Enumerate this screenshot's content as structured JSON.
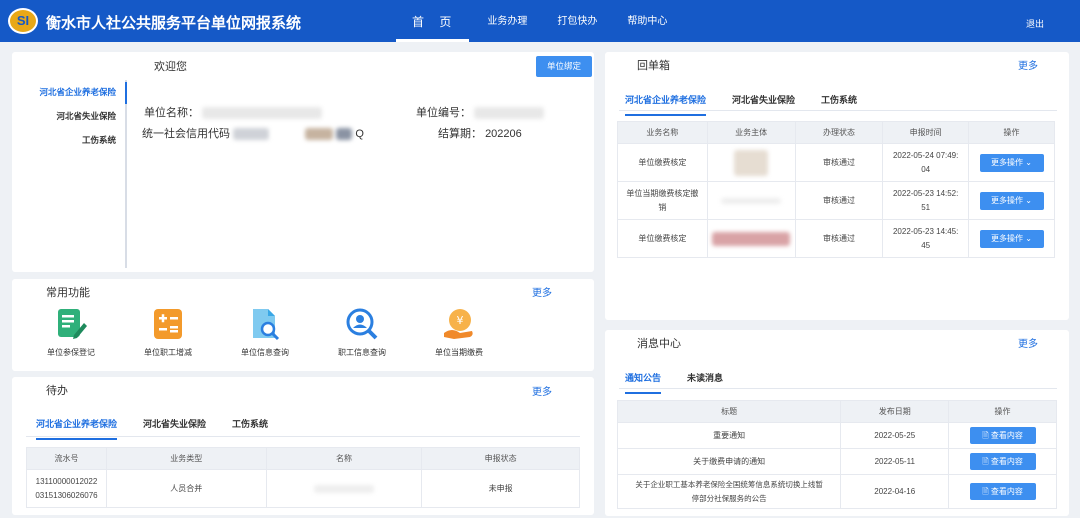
{
  "header": {
    "logo_text": "SI",
    "title": "衡水市人社公共服务平台单位网报系统",
    "nav": [
      "首 页",
      "业务办理",
      "打包快办",
      "帮助中心"
    ],
    "logout": "退出"
  },
  "welcome": {
    "title": "欢迎您",
    "button": "单位绑定",
    "tabs": [
      "河北省企业养老保险",
      "河北省失业保险",
      "工伤系统"
    ],
    "unit_name_label": "单位名称：",
    "unit_code_label": "单位编号：",
    "credit_code_label": "统一社会信用代码",
    "credit_code_tail": "Q",
    "settle_label": "结算期：",
    "settle_value": "202206"
  },
  "common": {
    "title": "常用功能",
    "more": "更多",
    "items": [
      {
        "label": "单位参保登记",
        "icon": "register-edit-icon",
        "color": "#2fb07a"
      },
      {
        "label": "单位职工增减",
        "icon": "calculator-icon",
        "color": "#f39a2b"
      },
      {
        "label": "单位信息查询",
        "icon": "document-search-icon",
        "color": "#39a7e6"
      },
      {
        "label": "职工信息查询",
        "icon": "person-search-icon",
        "color": "#2b7fe0"
      },
      {
        "label": "单位当期缴费",
        "icon": "yuan-payment-icon",
        "color": "#f0892a"
      }
    ]
  },
  "todo": {
    "title": "待办",
    "more": "更多",
    "tabs": [
      "河北省企业养老保险",
      "河北省失业保险",
      "工伤系统"
    ],
    "columns": [
      "流水号",
      "业务类型",
      "名称",
      "申报状态"
    ],
    "rows": [
      {
        "serial": "1311000001202203151306026076",
        "serial_line1": "13110000012022",
        "serial_line2": "03151306026076",
        "type": "人员合并",
        "name": "",
        "status": "未申报"
      }
    ]
  },
  "inbox": {
    "title": "回单箱",
    "more": "更多",
    "tabs": [
      "河北省企业养老保险",
      "河北省失业保险",
      "工伤系统"
    ],
    "columns": [
      "业务名称",
      "业务主体",
      "办理状态",
      "申报时间",
      "操作"
    ],
    "rows": [
      {
        "name": "单位缴费核定",
        "subject": "",
        "status": "审核通过",
        "time_line1": "2022-05-24 07:49:",
        "time_line2": "04",
        "action": "更多操作"
      },
      {
        "name_line1": "单位当期缴费核定撤",
        "name_line2": "销",
        "subject": "",
        "status": "审核通过",
        "time_line1": "2022-05-23 14:52:",
        "time_line2": "51",
        "action": "更多操作"
      },
      {
        "name": "单位缴费核定",
        "subject": "",
        "status": "审核通过",
        "time_line1": "2022-05-23 14:45:",
        "time_line2": "45",
        "action": "更多操作"
      }
    ]
  },
  "messages": {
    "title": "消息中心",
    "more": "更多",
    "tabs": [
      "通知公告",
      "未读消息"
    ],
    "columns": [
      "标题",
      "发布日期",
      "操作"
    ],
    "rows": [
      {
        "title": "重要通知",
        "date": "2022-05-25",
        "action": "查看内容"
      },
      {
        "title": "关于缴费申请的通知",
        "date": "2022-05-11",
        "action": "查看内容"
      },
      {
        "title_line1": "关于企业职工基本养老保险全国统筹信息系统切换上线暂",
        "title_line2": "停部分社保服务的公告",
        "date": "2022-04-16",
        "action": "查看内容"
      }
    ]
  },
  "colors": {
    "header_bg": "#1559c7",
    "accent": "#1f6fe0",
    "button": "#3d8ff0"
  }
}
